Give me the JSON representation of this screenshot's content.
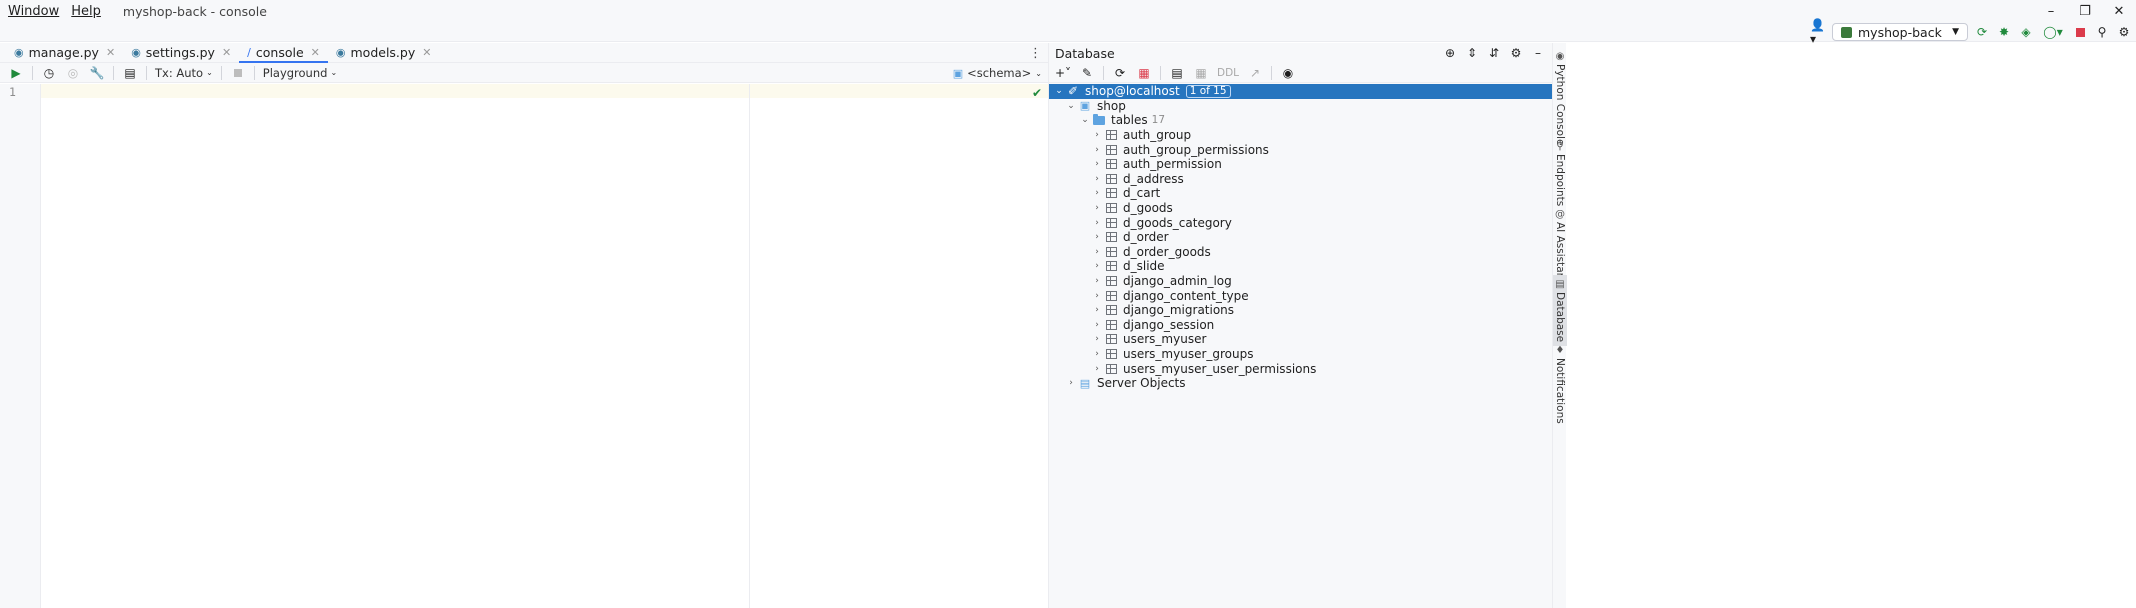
{
  "menu": {
    "items": [
      "Window",
      "Help"
    ],
    "window_title": "myshop-back - console"
  },
  "toolbar": {
    "run_config": "myshop-back"
  },
  "editor_tabs": [
    {
      "label": "manage.py",
      "active": false
    },
    {
      "label": "settings.py",
      "active": false
    },
    {
      "label": "console",
      "active": true
    },
    {
      "label": "models.py",
      "active": false
    }
  ],
  "console_toolbar": {
    "tx_mode": "Tx: Auto",
    "playground": "Playground",
    "schema": "<schema>"
  },
  "editor": {
    "line_number": "1"
  },
  "database": {
    "title": "Database",
    "ddl_label": "DDL",
    "connection": {
      "label": "shop@localhost",
      "badge": "1 of 15"
    },
    "schema": "shop",
    "tables_folder": {
      "label": "tables",
      "count": "17"
    },
    "tables": [
      "auth_group",
      "auth_group_permissions",
      "auth_permission",
      "d_address",
      "d_cart",
      "d_goods",
      "d_goods_category",
      "d_order",
      "d_order_goods",
      "d_slide",
      "django_admin_log",
      "django_content_type",
      "django_migrations",
      "django_session",
      "users_myuser",
      "users_myuser_groups",
      "users_myuser_user_permissions"
    ],
    "server_objects": "Server Objects"
  },
  "tool_strip": [
    "Python Console",
    "Endpoints",
    "AI Assistant",
    "Database",
    "Notifications"
  ],
  "colors": {
    "selection": "#2675bf",
    "accent": "#3574f0",
    "run_green": "#208a3c",
    "stop_red": "#db3b4b"
  }
}
